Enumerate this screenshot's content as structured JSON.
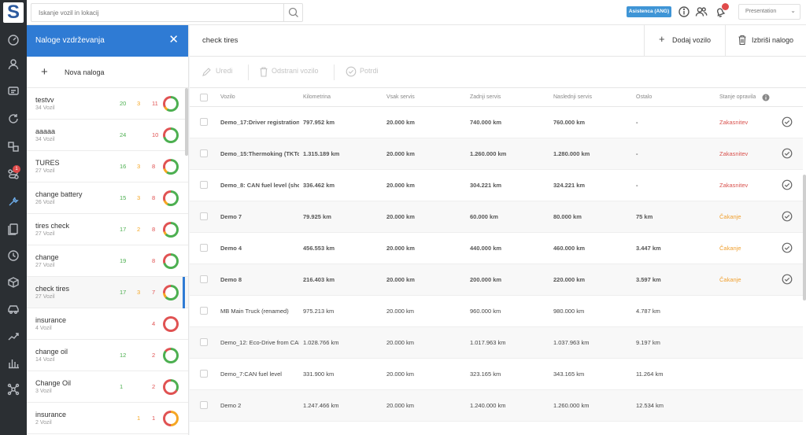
{
  "search": {
    "placeholder": "Iskanje vozil in lokacij"
  },
  "header": {
    "assist_label": "Asistenca (ANG)",
    "account": "Presentation"
  },
  "sidebar": {
    "items": [
      "dashboard-icon",
      "user-icon",
      "messages-icon",
      "refresh-icon",
      "transfer-icon",
      "routes-icon",
      "maintenance-icon",
      "documents-icon",
      "clock-icon",
      "box-icon",
      "car-icon",
      "trends-icon",
      "stats-icon",
      "network-icon"
    ],
    "badge": "1"
  },
  "panel": {
    "title": "Naloge vzdrževanja",
    "new_label": "Nova naloga",
    "groups": [
      {
        "name": "testvv",
        "count": "34 Vozil",
        "a": "20",
        "b": "3",
        "c": "11"
      },
      {
        "name": "aaaaa",
        "count": "34 Vozil",
        "a": "24",
        "b": "",
        "c": "10"
      },
      {
        "name": "TURES",
        "count": "27 Vozil",
        "a": "16",
        "b": "3",
        "c": "8"
      },
      {
        "name": "change battery",
        "count": "26 Vozil",
        "a": "15",
        "b": "3",
        "c": "8"
      },
      {
        "name": "tires check",
        "count": "27 Vozil",
        "a": "17",
        "b": "2",
        "c": "8"
      },
      {
        "name": "change",
        "count": "27 Vozil",
        "a": "19",
        "b": "",
        "c": "8"
      },
      {
        "name": "check tires",
        "count": "27 Vozil",
        "a": "17",
        "b": "3",
        "c": "7"
      },
      {
        "name": "insurance",
        "count": "4 Vozil",
        "a": "",
        "b": "",
        "c": "4"
      },
      {
        "name": "change oil",
        "count": "14 Vozil",
        "a": "12",
        "b": "",
        "c": "2"
      },
      {
        "name": "Change Oil",
        "count": "3 Vozil",
        "a": "1",
        "b": "",
        "c": "2"
      },
      {
        "name": "insurance",
        "count": "2 Vozil",
        "a": "",
        "b": "1",
        "c": "1"
      }
    ]
  },
  "main": {
    "title": "check tires",
    "add_label": "Dodaj vozilo",
    "delete_label": "Izbriši nalogo",
    "toolbar": {
      "edit": "Uredi",
      "remove": "Odstrani vozilo",
      "confirm": "Potrdi"
    },
    "columns": [
      "Vozilo",
      "Kilometrina",
      "Vsak servis",
      "Zadnji servis",
      "Naslednji servis",
      "Ostalo",
      "Stanje opravila"
    ],
    "rows": [
      {
        "vehicle": "Demo_17:Driver registration i...",
        "km": "797.952 km",
        "every": "20.000 km",
        "last": "740.000 km",
        "next": "760.000 km",
        "left": "-",
        "status": "Zakasnitev",
        "st": "red"
      },
      {
        "vehicle": "Demo_15:Thermoking (TKTou...",
        "km": "1.315.189 km",
        "every": "20.000 km",
        "last": "1.260.000 km",
        "next": "1.280.000 km",
        "left": "-",
        "status": "Zakasnitev",
        "st": "red"
      },
      {
        "vehicle": "Demo_8: CAN fuel level (shows...",
        "km": "336.462 km",
        "every": "20.000 km",
        "last": "304.221 km",
        "next": "324.221 km",
        "left": "-",
        "status": "Zakasnitev",
        "st": "red"
      },
      {
        "vehicle": "Demo 7",
        "km": "79.925 km",
        "every": "20.000 km",
        "last": "60.000 km",
        "next": "80.000 km",
        "left": "75 km",
        "status": "Čakanje",
        "st": "orange"
      },
      {
        "vehicle": "Demo 4",
        "km": "456.553 km",
        "every": "20.000 km",
        "last": "440.000 km",
        "next": "460.000 km",
        "left": "3.447 km",
        "status": "Čakanje",
        "st": "orange"
      },
      {
        "vehicle": "Demo 8",
        "km": "216.403 km",
        "every": "20.000 km",
        "last": "200.000 km",
        "next": "220.000 km",
        "left": "3.597 km",
        "status": "Čakanje",
        "st": "orange"
      },
      {
        "vehicle": "MB Main Truck (renamed)",
        "km": "975.213 km",
        "every": "20.000 km",
        "last": "960.000 km",
        "next": "980.000 km",
        "left": "4.787 km",
        "status": "",
        "st": ""
      },
      {
        "vehicle": "Demo_12: Eco-Drive from CAN",
        "km": "1.028.766 km",
        "every": "20.000 km",
        "last": "1.017.963 km",
        "next": "1.037.963 km",
        "left": "9.197 km",
        "status": "",
        "st": ""
      },
      {
        "vehicle": "Demo_7:CAN fuel level",
        "km": "331.900 km",
        "every": "20.000 km",
        "last": "323.165 km",
        "next": "343.165 km",
        "left": "11.264 km",
        "status": "",
        "st": ""
      },
      {
        "vehicle": "Demo 2",
        "km": "1.247.466 km",
        "every": "20.000 km",
        "last": "1.240.000 km",
        "next": "1.260.000 km",
        "left": "12.534 km",
        "status": "",
        "st": ""
      }
    ]
  },
  "colors": {
    "accent": "#2f7bd4",
    "nav": "#2b2f33",
    "ok": "#4caf50",
    "warn": "#f5a623",
    "late": "#e05252"
  }
}
